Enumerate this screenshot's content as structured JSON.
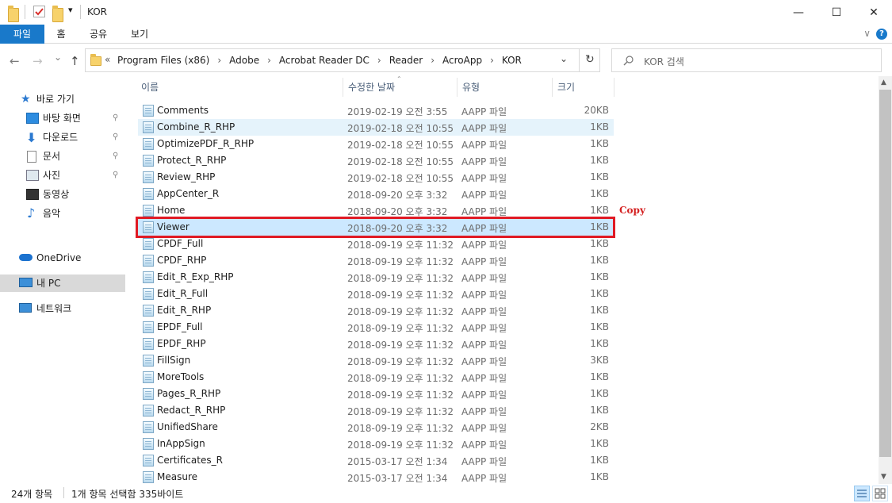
{
  "window": {
    "title": "KOR",
    "qat_dropdown": "▾",
    "minimize": "—",
    "maximize": "☐",
    "close": "✕"
  },
  "ribbon": {
    "tabs": [
      "파일",
      "홈",
      "공유",
      "보기"
    ],
    "expand_icon": "∨",
    "help": "?"
  },
  "nav": {
    "back": "←",
    "forward": "→",
    "recent": "⌄",
    "up": "↑",
    "overflow": "«",
    "breadcrumbs": [
      "Program Files (x86)",
      "Adobe",
      "Acrobat Reader DC",
      "Reader",
      "AcroApp",
      "KOR"
    ],
    "separator": "›",
    "dropdown": "⌄",
    "refresh": "↻",
    "search_placeholder": "KOR 검색"
  },
  "sidebar": {
    "quick_access": "바로 가기",
    "items": [
      {
        "label": "바탕 화면",
        "icon": "desktop-icon",
        "pinned": true
      },
      {
        "label": "다운로드",
        "icon": "download-icon",
        "pinned": true
      },
      {
        "label": "문서",
        "icon": "documents-icon",
        "pinned": true
      },
      {
        "label": "사진",
        "icon": "pictures-icon",
        "pinned": true
      },
      {
        "label": "동영상",
        "icon": "videos-icon",
        "pinned": false
      },
      {
        "label": "음악",
        "icon": "music-icon",
        "pinned": false
      }
    ],
    "onedrive": "OneDrive",
    "this_pc": "내 PC",
    "network": "네트워크",
    "pin_glyph": "📌"
  },
  "columns": {
    "name": "이름",
    "date": "수정한 날짜",
    "type": "유형",
    "size": "크기"
  },
  "files": [
    {
      "name": "Comments",
      "date": "2019-02-19 오전 3:55",
      "type": "AAPP 파일",
      "size": "20KB"
    },
    {
      "name": "Combine_R_RHP",
      "date": "2019-02-18 오전 10:55",
      "type": "AAPP 파일",
      "size": "1KB"
    },
    {
      "name": "OptimizePDF_R_RHP",
      "date": "2019-02-18 오전 10:55",
      "type": "AAPP 파일",
      "size": "1KB"
    },
    {
      "name": "Protect_R_RHP",
      "date": "2019-02-18 오전 10:55",
      "type": "AAPP 파일",
      "size": "1KB"
    },
    {
      "name": "Review_RHP",
      "date": "2019-02-18 오전 10:55",
      "type": "AAPP 파일",
      "size": "1KB"
    },
    {
      "name": "AppCenter_R",
      "date": "2018-09-20 오후 3:32",
      "type": "AAPP 파일",
      "size": "1KB"
    },
    {
      "name": "Home",
      "date": "2018-09-20 오후 3:32",
      "type": "AAPP 파일",
      "size": "1KB"
    },
    {
      "name": "Viewer",
      "date": "2018-09-20 오후 3:32",
      "type": "AAPP 파일",
      "size": "1KB"
    },
    {
      "name": "CPDF_Full",
      "date": "2018-09-19 오후 11:32",
      "type": "AAPP 파일",
      "size": "1KB"
    },
    {
      "name": "CPDF_RHP",
      "date": "2018-09-19 오후 11:32",
      "type": "AAPP 파일",
      "size": "1KB"
    },
    {
      "name": "Edit_R_Exp_RHP",
      "date": "2018-09-19 오후 11:32",
      "type": "AAPP 파일",
      "size": "1KB"
    },
    {
      "name": "Edit_R_Full",
      "date": "2018-09-19 오후 11:32",
      "type": "AAPP 파일",
      "size": "1KB"
    },
    {
      "name": "Edit_R_RHP",
      "date": "2018-09-19 오후 11:32",
      "type": "AAPP 파일",
      "size": "1KB"
    },
    {
      "name": "EPDF_Full",
      "date": "2018-09-19 오후 11:32",
      "type": "AAPP 파일",
      "size": "1KB"
    },
    {
      "name": "EPDF_RHP",
      "date": "2018-09-19 오후 11:32",
      "type": "AAPP 파일",
      "size": "1KB"
    },
    {
      "name": "FillSign",
      "date": "2018-09-19 오후 11:32",
      "type": "AAPP 파일",
      "size": "3KB"
    },
    {
      "name": "MoreTools",
      "date": "2018-09-19 오후 11:32",
      "type": "AAPP 파일",
      "size": "1KB"
    },
    {
      "name": "Pages_R_RHP",
      "date": "2018-09-19 오후 11:32",
      "type": "AAPP 파일",
      "size": "1KB"
    },
    {
      "name": "Redact_R_RHP",
      "date": "2018-09-19 오후 11:32",
      "type": "AAPP 파일",
      "size": "1KB"
    },
    {
      "name": "UnifiedShare",
      "date": "2018-09-19 오후 11:32",
      "type": "AAPP 파일",
      "size": "2KB"
    },
    {
      "name": "InAppSign",
      "date": "2018-09-19 오후 11:32",
      "type": "AAPP 파일",
      "size": "1KB"
    },
    {
      "name": "Certificates_R",
      "date": "2015-03-17 오전 1:34",
      "type": "AAPP 파일",
      "size": "1KB"
    },
    {
      "name": "Measure",
      "date": "2015-03-17 오전 1:34",
      "type": "AAPP 파일",
      "size": "1KB"
    }
  ],
  "selected_file": "Viewer",
  "hovered_file": "Combine_R_RHP",
  "annotation": "Copy",
  "status": {
    "count": "24개 항목",
    "selection": "1개 항목 선택함 335바이트"
  },
  "colors": {
    "accent": "#1979ca",
    "selection": "#cce8ff",
    "hover": "#e5f3fb",
    "highlight": "#e01a24"
  }
}
